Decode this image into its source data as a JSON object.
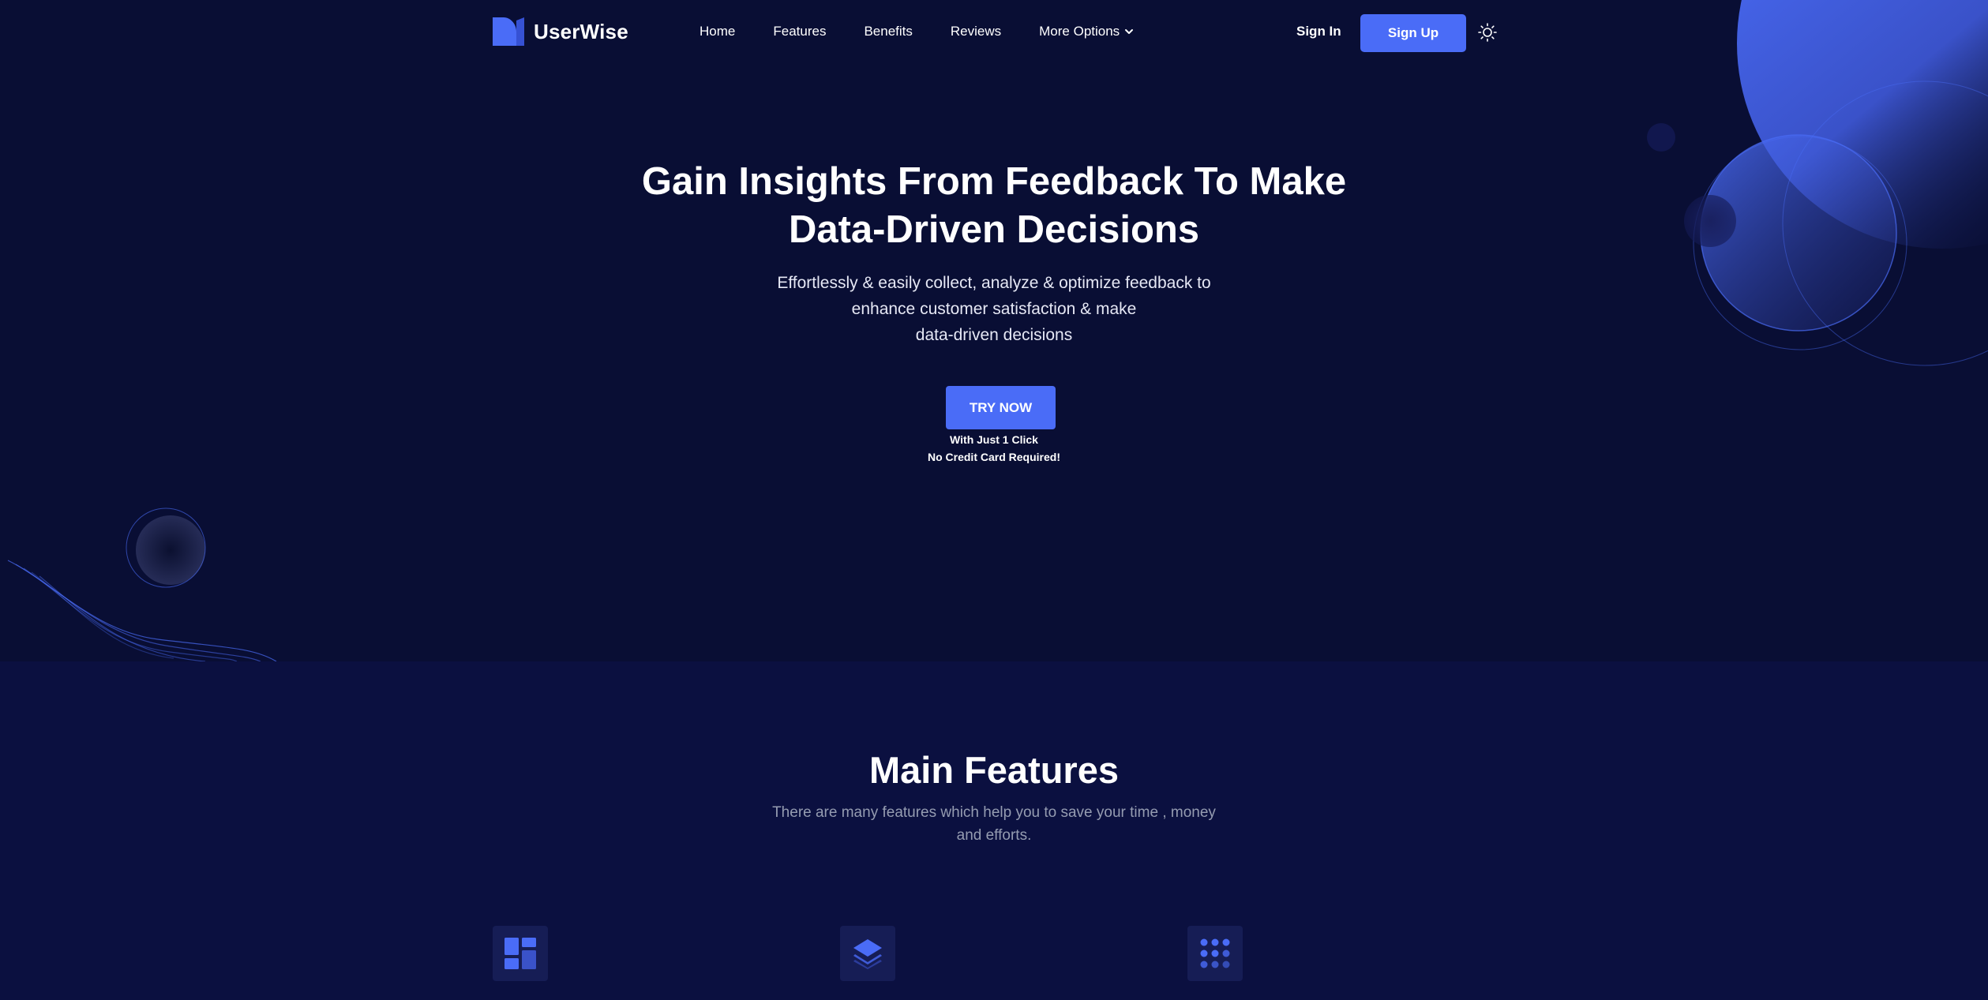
{
  "brand": {
    "name": "UserWise",
    "accent": "#4a6cf7",
    "background": "#090e34"
  },
  "nav": {
    "items": [
      {
        "label": "Home"
      },
      {
        "label": "Features"
      },
      {
        "label": "Benefits"
      },
      {
        "label": "Reviews"
      },
      {
        "label": "More Options",
        "icon": "chevron-down-icon"
      }
    ],
    "signin_label": "Sign In",
    "signup_label": "Sign Up",
    "theme_icon": "sun-icon"
  },
  "hero": {
    "title_lines": [
      "Gain Insights From Feedback To Make",
      "Data-Driven Decisions"
    ],
    "subtitle_lines": [
      "Effortlessly & easily collect, analyze & optimize feedback to",
      "enhance customer satisfaction & make",
      "data-driven decisions"
    ],
    "cta_label": "TRY NOW",
    "cta_note_lines": [
      "With Just 1 Click",
      "No Credit Card Required!"
    ]
  },
  "features": {
    "title": "Main Features",
    "subtitle_lines": [
      "There are many features which help you to save your time , money",
      "and efforts."
    ],
    "icons": [
      "dashboard-icon",
      "layers-icon",
      "grid-dots-icon"
    ]
  }
}
